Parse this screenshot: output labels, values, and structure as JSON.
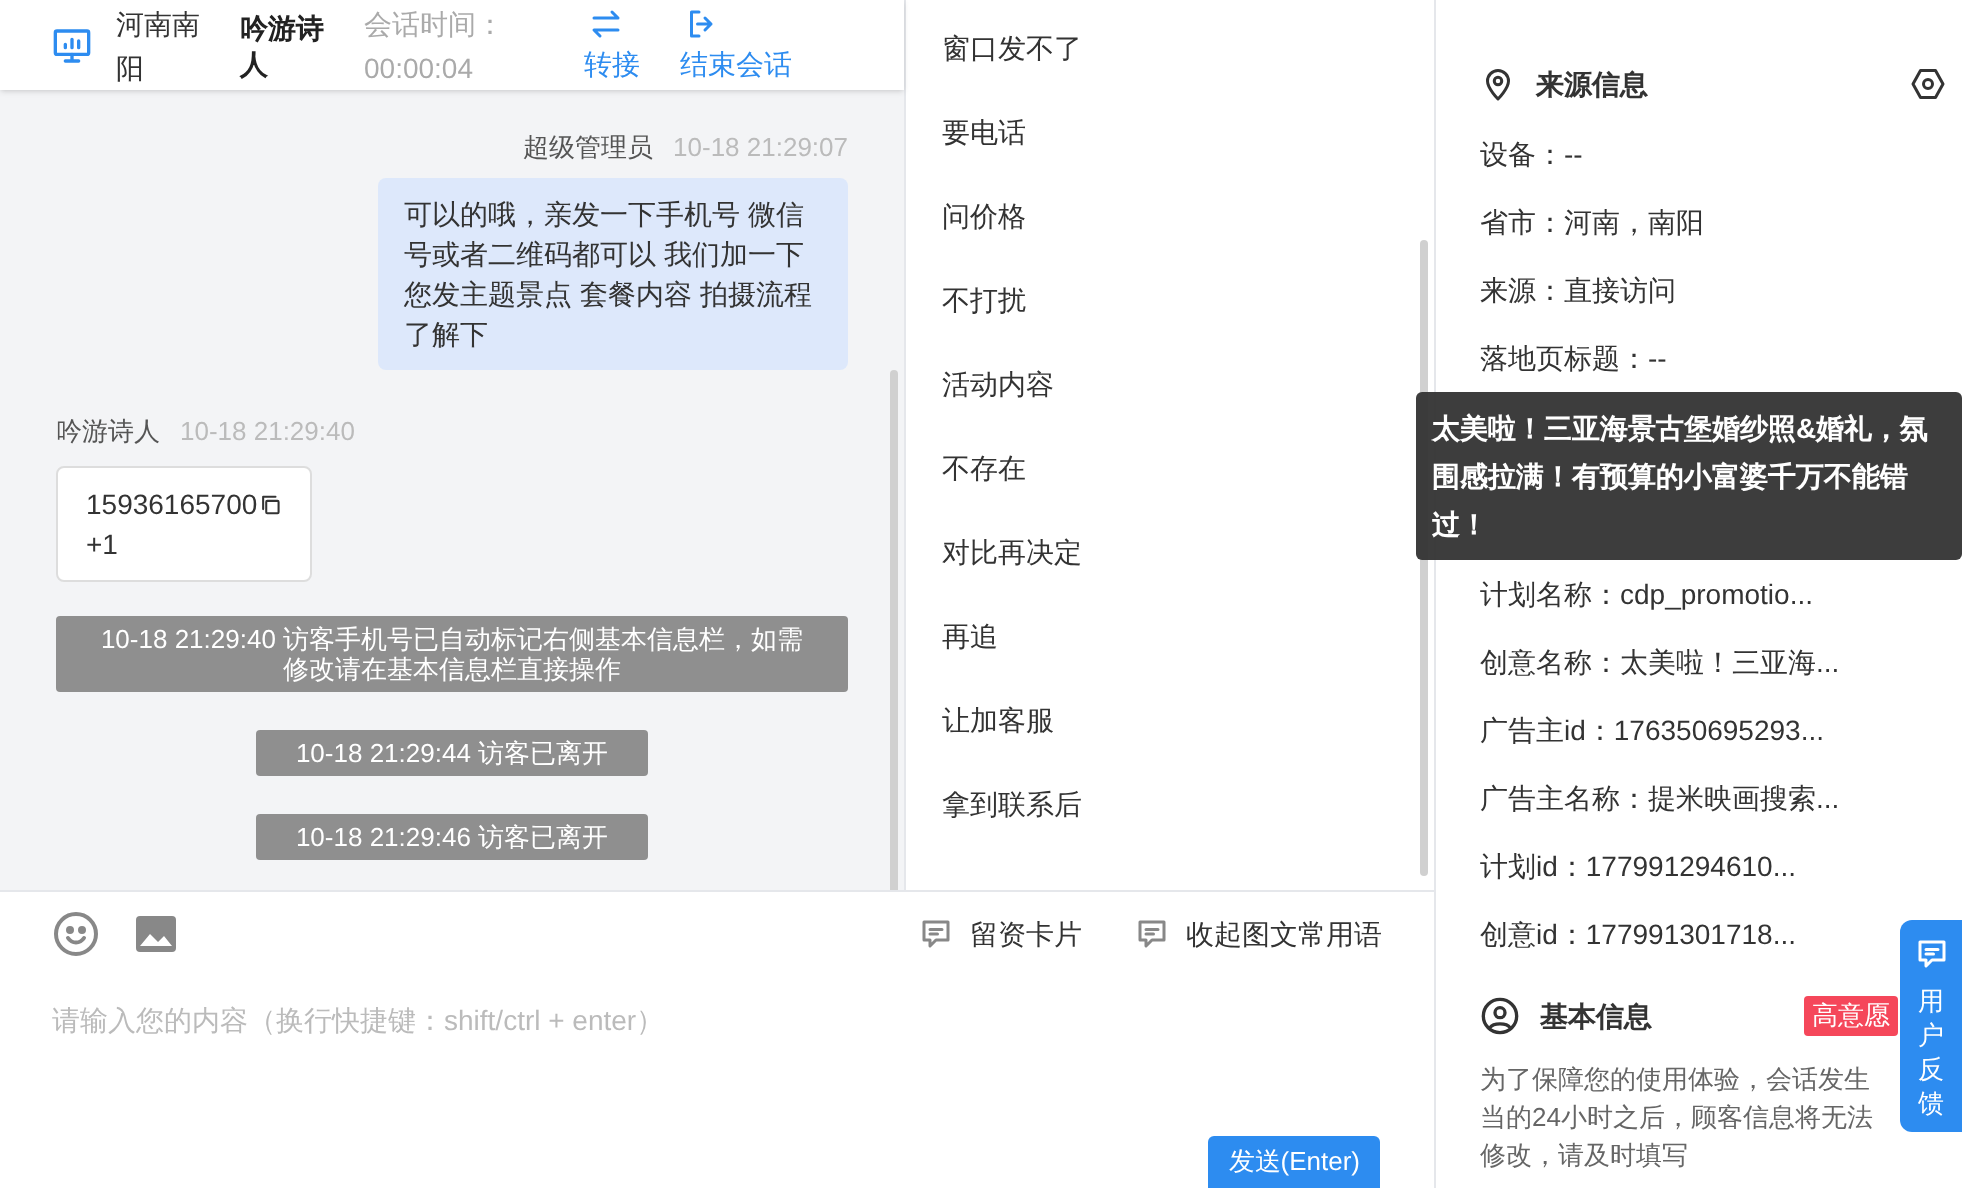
{
  "header": {
    "location": "河南南阳",
    "visitor": "吟游诗人",
    "session_time_label": "会话时间：",
    "session_time": "00:00:04",
    "actions": [
      {
        "kind": "transfer",
        "label": "转接"
      },
      {
        "kind": "end",
        "label": "结束会话"
      }
    ]
  },
  "messages": [
    {
      "kind": "agent",
      "sender": "超级管理员",
      "time": "10-18 21:29:07",
      "text": "可以的哦，亲发一下手机号 微信号或者二维码都可以 我们加一下您发主题景点 套餐内容 拍摄流程了解下"
    },
    {
      "kind": "visitor",
      "sender": "吟游诗人",
      "time": "10-18 21:29:40",
      "phone": "15936165700",
      "extra": "+1"
    },
    {
      "kind": "system",
      "text": "10-18 21:29:40 访客手机号已自动标记右侧基本信息栏，如需修改请在基本信息栏直接操作"
    },
    {
      "kind": "system",
      "text": "10-18 21:29:44 访客已离开"
    },
    {
      "kind": "system",
      "text": "10-18 21:29:46 访客已离开"
    }
  ],
  "quick_phrases": [
    "窗口发不了",
    "要电话",
    "问价格",
    "不打扰",
    "活动内容",
    "不存在",
    "对比再决定",
    "再追",
    "让加客服",
    "拿到联系后"
  ],
  "composer": {
    "tools": [
      {
        "kind": "emoji"
      },
      {
        "kind": "image"
      }
    ],
    "links": [
      "留资卡片",
      "收起图文常用语"
    ],
    "placeholder": "请输入您的内容（换行快捷键：shift/ctrl + enter）",
    "send": "发送(Enter)"
  },
  "source_info": {
    "title": "来源信息",
    "rows": [
      {
        "kind": "row",
        "text": "设备：--"
      },
      {
        "kind": "row",
        "text": "省市：河南，南阳"
      },
      {
        "kind": "row",
        "text": "来源：直接访问"
      },
      {
        "kind": "row",
        "text": "落地页标题：--"
      },
      {
        "kind": "tooltip",
        "text": "太美啦！三亚海景古堡婚纱照&婚礼，氛围感拉满！有预算的小富婆千万不能错过！"
      },
      {
        "kind": "row",
        "text": "计划名称：cdp_promotio..."
      },
      {
        "kind": "row",
        "text": "创意名称：太美啦！三亚海..."
      },
      {
        "kind": "row",
        "text": "广告主id：176350695293..."
      },
      {
        "kind": "row",
        "text": "广告主名称：提米映画搜索..."
      },
      {
        "kind": "row",
        "text": "计划id：177991294610..."
      },
      {
        "kind": "row",
        "text": "创意id：177991301718..."
      }
    ]
  },
  "basic_info": {
    "title": "基本信息",
    "badge": "高意愿",
    "notice": "为了保障您的使用体验，会话发生当的24小时之后，顾客信息将无法修改，请及时填写"
  },
  "feedback": "用户反馈"
}
